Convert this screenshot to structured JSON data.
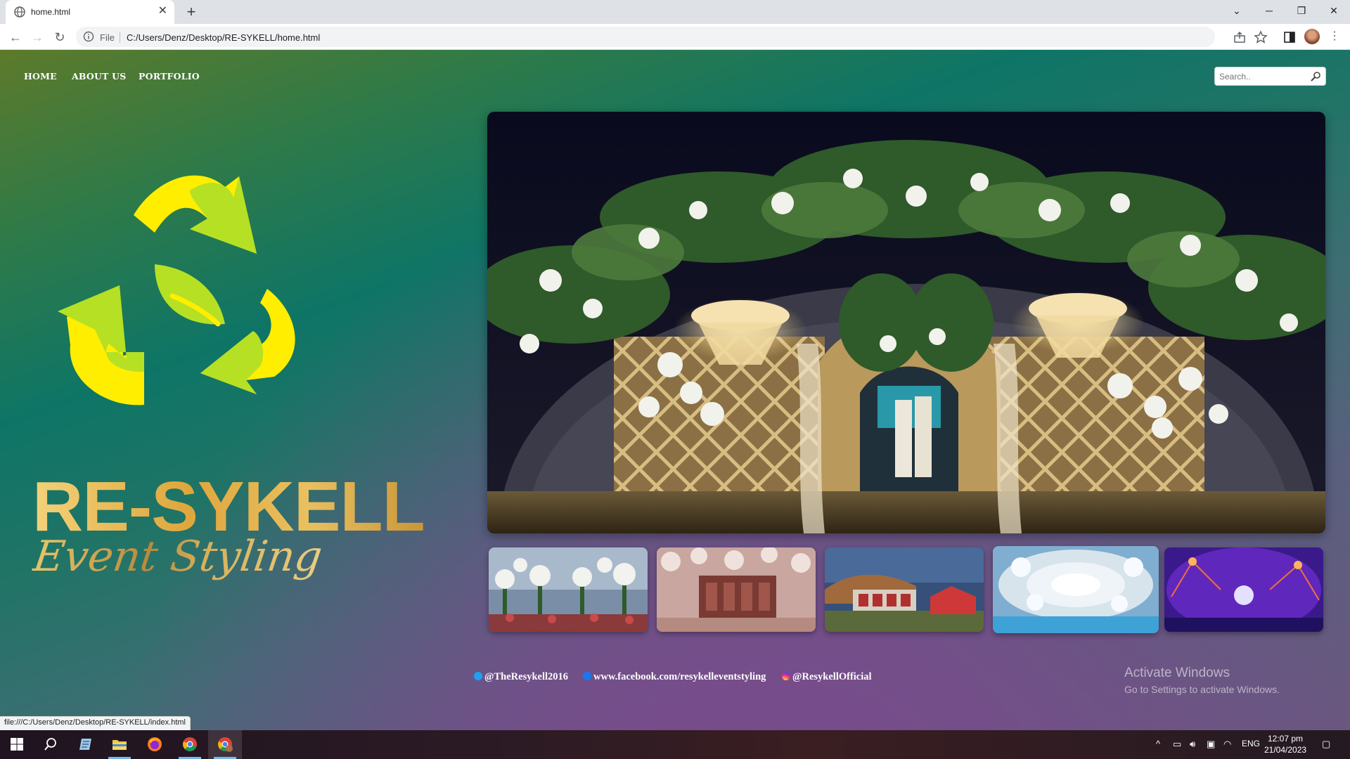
{
  "browser": {
    "tab_title": "home.html",
    "scheme_label": "File",
    "url": "C:/Users/Denz/Desktop/RE-SYKELL/home.html",
    "status_url": "file:///C:/Users/Denz/Desktop/RE-SYKELL/index.html"
  },
  "nav": {
    "items": [
      {
        "label": "HOME"
      },
      {
        "label": "ABOUT US"
      },
      {
        "label": "PORTFOLIO"
      }
    ]
  },
  "search": {
    "placeholder": "Search.."
  },
  "brand": {
    "title": "RE-SYKELL",
    "subtitle": "Event Styling"
  },
  "gallery": {
    "hero_icon": "hero-photo",
    "thumbnails": [
      "thumbnail-1",
      "thumbnail-2",
      "thumbnail-3",
      "thumbnail-4",
      "thumbnail-5"
    ]
  },
  "social": {
    "twitter": "@TheResykell2016",
    "facebook": "www.facebook.com/resykelleventstyling",
    "instagram": "@ResykellOfficial"
  },
  "watermark": {
    "line1": "Activate Windows",
    "line2": "Go to Settings to activate Windows."
  },
  "taskbar": {
    "language": "ENG",
    "time": "12:07 pm",
    "date": "21/04/2023"
  },
  "colors": {
    "brand_gold": "#dfa63c",
    "logo_yellow": "#ffee00",
    "logo_green": "#b6e024",
    "page_teal": "#0e7566",
    "page_purple": "#7a4a8c"
  }
}
